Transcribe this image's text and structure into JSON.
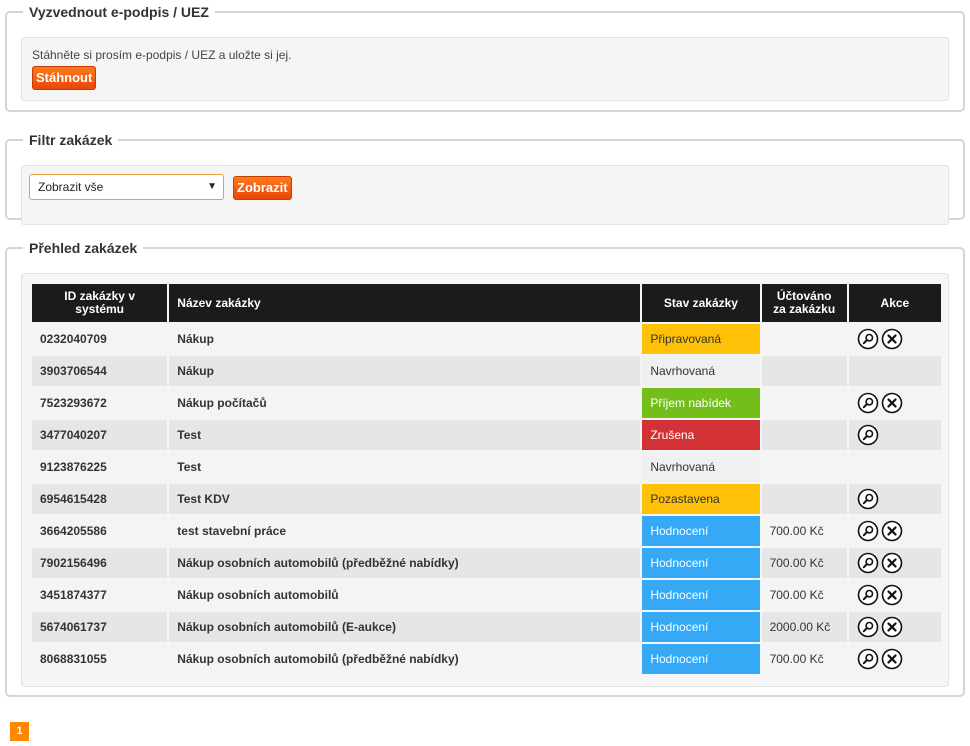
{
  "epodpis": {
    "legend": "Vyzvednout e-podpis / UEZ",
    "text": "Stáhněte si prosím e-podpis / UEZ a uložte si jej.",
    "download_label": "Stáhnout"
  },
  "filtr": {
    "legend": "Filtr zakázek",
    "selected_option": "Zobrazit vše",
    "show_label": "Zobrazit"
  },
  "prehled": {
    "legend": "Přehled zakázek",
    "columns": {
      "id": "ID zakázky v systému",
      "name": "Název zakázky",
      "status": "Stav zakázky",
      "billed": "Účtováno za zakázku",
      "actions": "Akce"
    },
    "rows": [
      {
        "id": "0232040709",
        "name": "Nákup",
        "status": "Připravovaná",
        "billed": "",
        "actions": [
          "detail",
          "delete"
        ]
      },
      {
        "id": "3903706544",
        "name": "Nákup",
        "status": "Navrhovaná",
        "billed": "",
        "actions": []
      },
      {
        "id": "7523293672",
        "name": "Nákup počítačů",
        "status": "Příjem nabídek",
        "billed": "",
        "actions": [
          "detail",
          "delete"
        ]
      },
      {
        "id": "3477040207",
        "name": "Test",
        "status": "Zrušena",
        "billed": "",
        "actions": [
          "detail"
        ]
      },
      {
        "id": "9123876225",
        "name": "Test",
        "status": "Navrhovaná",
        "billed": "",
        "actions": []
      },
      {
        "id": "6954615428",
        "name": "Test KDV",
        "status": "Pozastavena",
        "billed": "",
        "actions": [
          "detail"
        ]
      },
      {
        "id": "3664205586",
        "name": "test stavební práce",
        "status": "Hodnocení",
        "billed": "700.00 Kč",
        "actions": [
          "detail",
          "delete"
        ]
      },
      {
        "id": "7902156496",
        "name": "Nákup osobních automobilů (předběžné nabídky)",
        "status": "Hodnocení",
        "billed": "700.00 Kč",
        "actions": [
          "detail",
          "delete"
        ]
      },
      {
        "id": "3451874377",
        "name": "Nákup osobních automobilů",
        "status": "Hodnocení",
        "billed": "700.00 Kč",
        "actions": [
          "detail",
          "delete"
        ]
      },
      {
        "id": "5674061737",
        "name": "Nákup osobních automobilů (E-aukce)",
        "status": "Hodnocení",
        "billed": "2000.00 Kč",
        "actions": [
          "detail",
          "delete"
        ]
      },
      {
        "id": "8068831055",
        "name": "Nákup osobních automobilů (předběžné nabídky)",
        "status": "Hodnocení",
        "billed": "700.00 Kč",
        "actions": [
          "detail",
          "delete"
        ]
      }
    ]
  },
  "pagination": {
    "current_page": "1"
  },
  "colors": {
    "accent_orange": "#ff7a1a",
    "status_pripravovana": "#ffc108",
    "status_prijem": "#74be1b",
    "status_zrusena": "#d23236",
    "status_hodnoceni": "#35a9f5",
    "header_dark": "#1b1b1b"
  },
  "icons": {
    "detail": "magnifier-icon",
    "delete": "close-circle-icon"
  }
}
